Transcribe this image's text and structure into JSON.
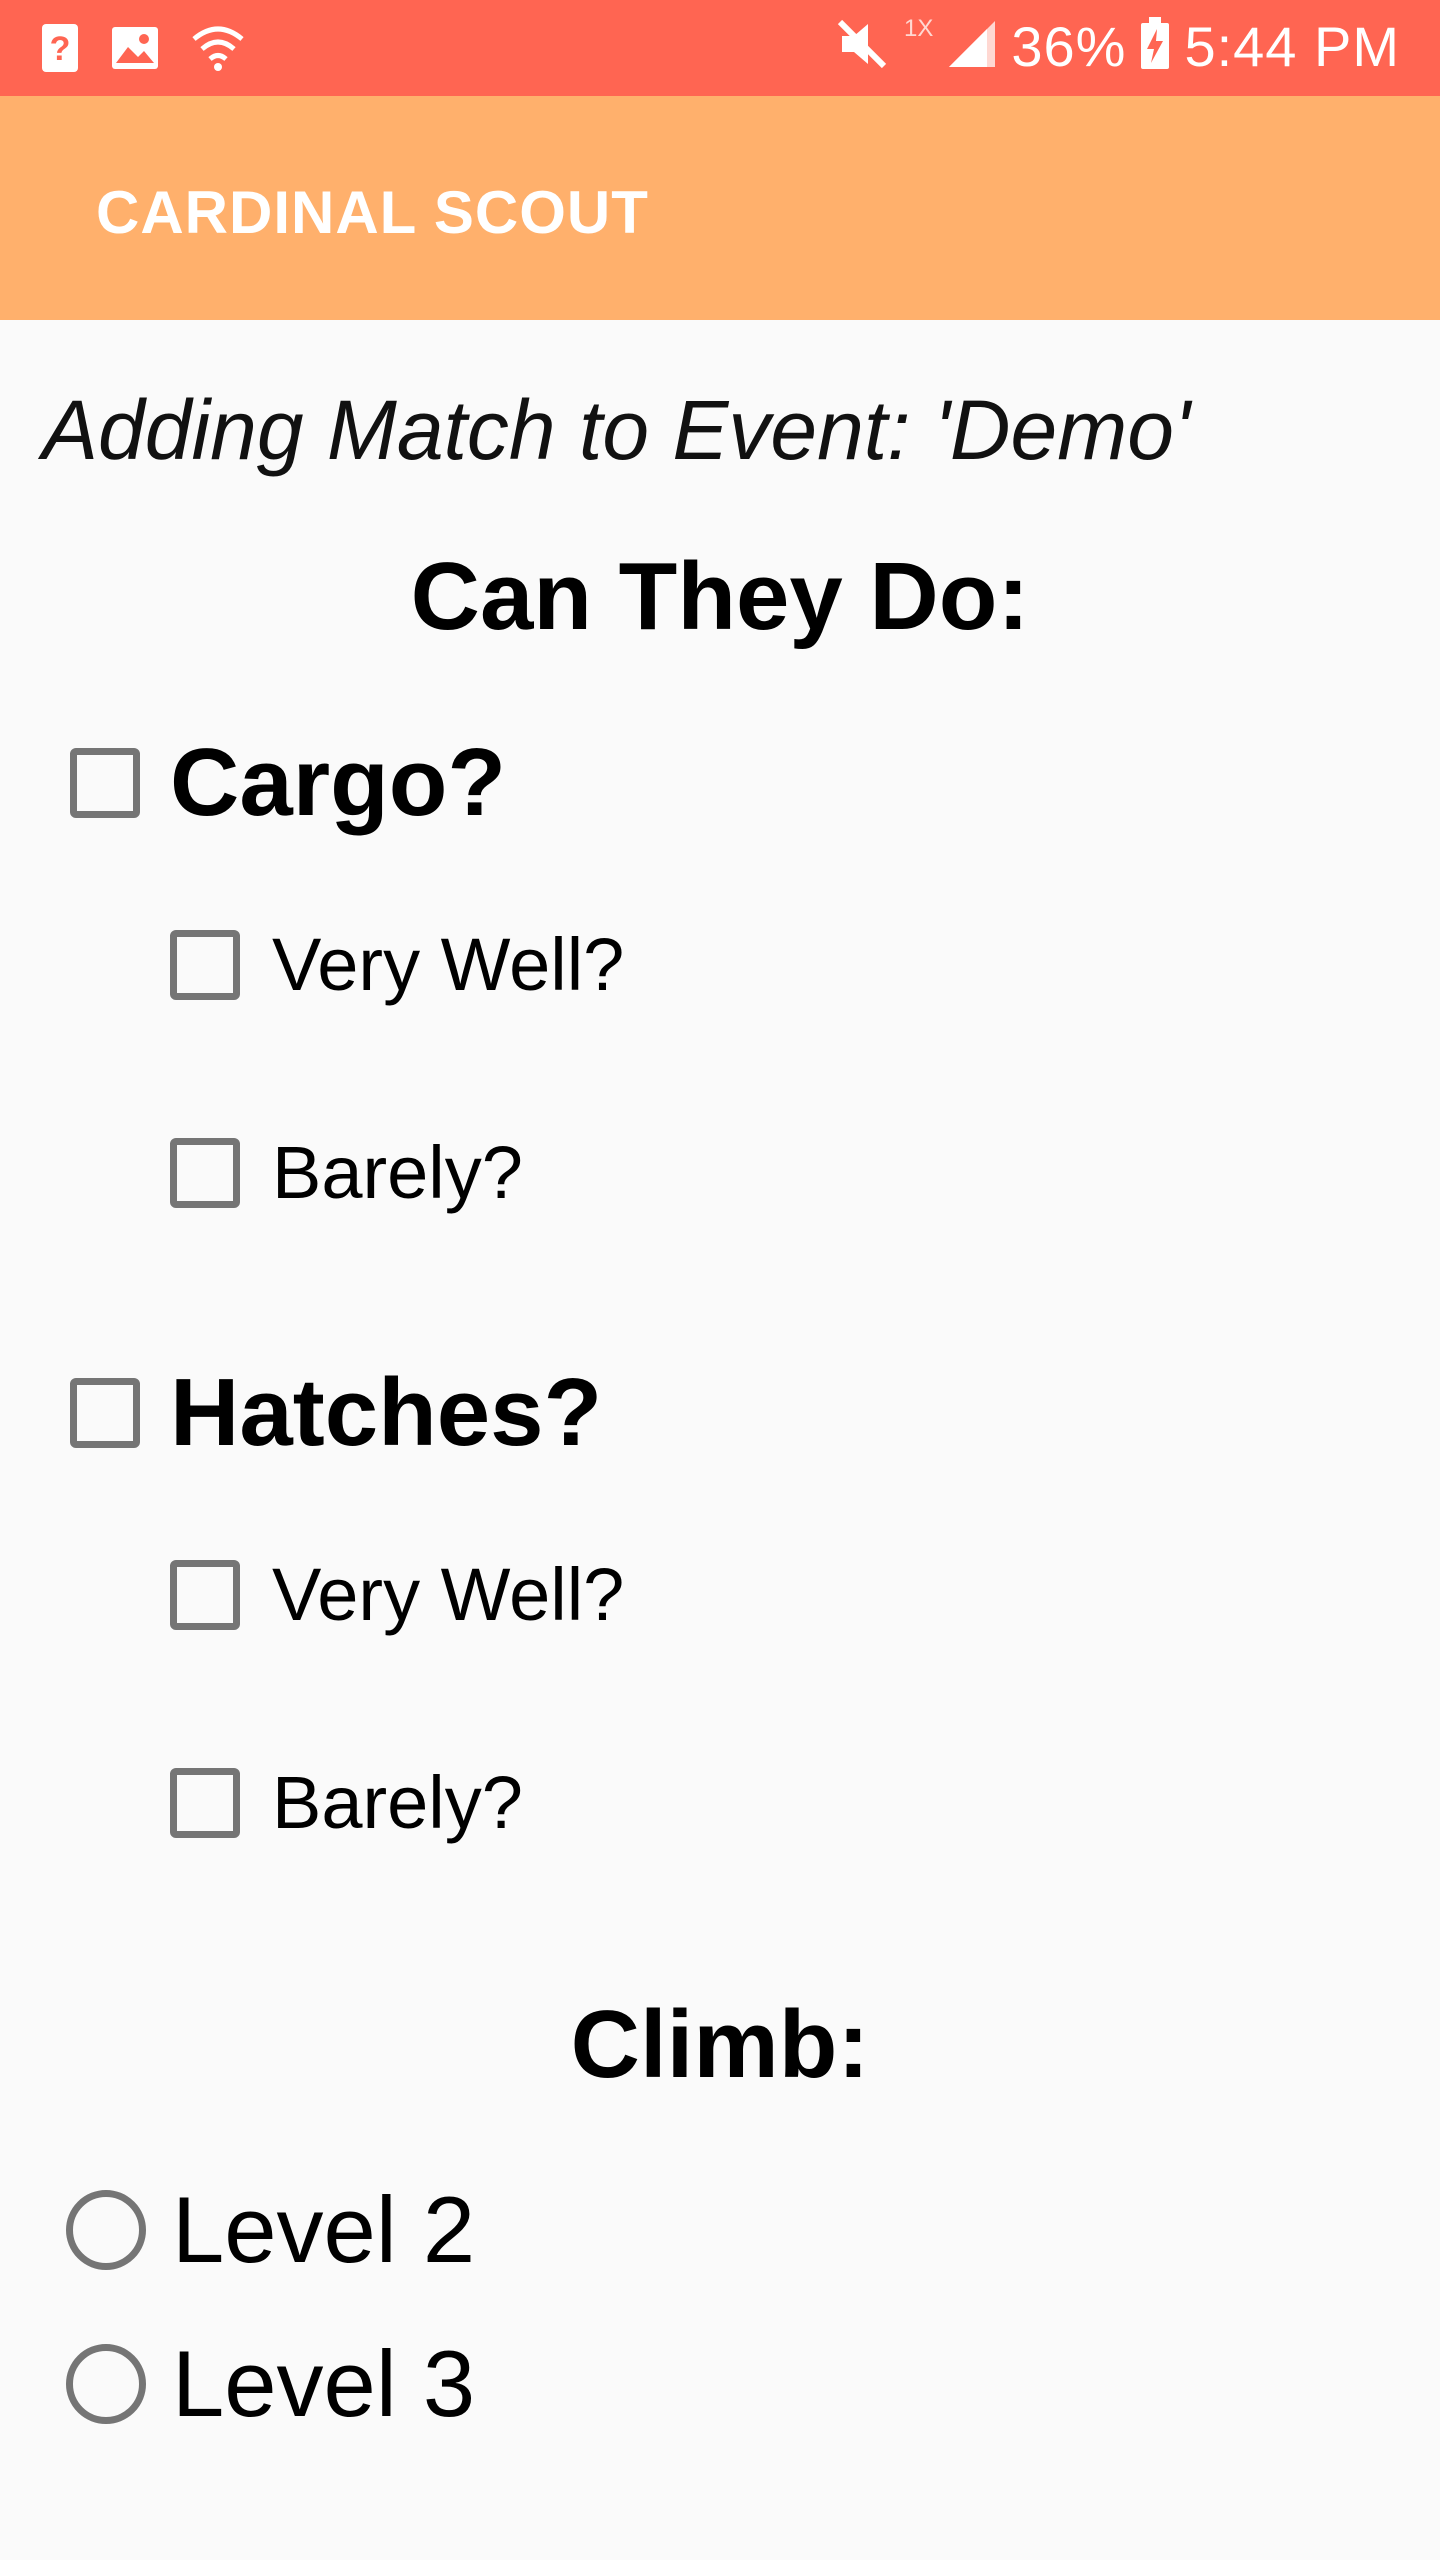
{
  "status_bar": {
    "battery": "36%",
    "time": "5:44 PM",
    "network_speed_tag": "1X",
    "icons": [
      "help-icon",
      "image-icon",
      "wifi-icon",
      "mute-icon",
      "signal-icon",
      "battery-charging-icon"
    ],
    "background": "#ff6552"
  },
  "app_bar": {
    "title": "CARDINAL SCOUT",
    "background": "#ffb06c"
  },
  "main": {
    "subtitle": "Adding Match to Event: 'Demo'",
    "can_they_do_title": "Can They Do:",
    "cargo": {
      "label": "Cargo?",
      "very_well": "Very Well?",
      "barely": "Barely?"
    },
    "hatches": {
      "label": "Hatches?",
      "very_well": "Very Well?",
      "barely": "Barely?"
    },
    "climb_title": "Climb:",
    "climb_options": [
      "Level 2",
      "Level 3"
    ]
  }
}
